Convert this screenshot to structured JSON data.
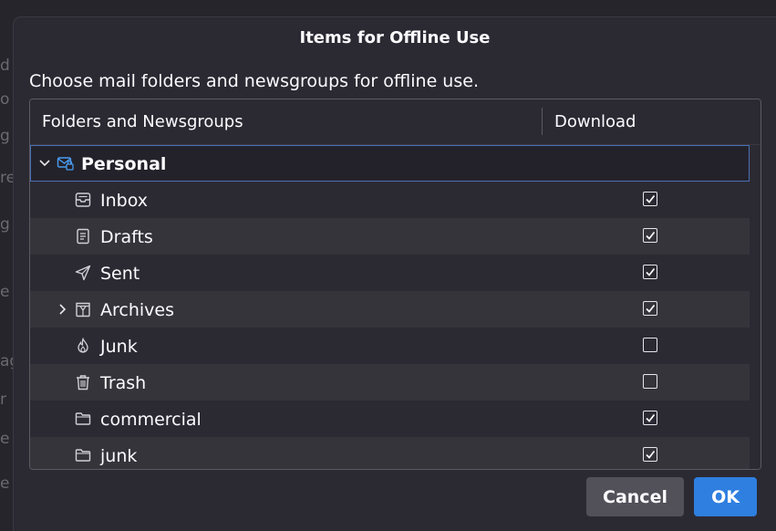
{
  "dialog": {
    "title": "Items for Offline Use",
    "intro": "Choose mail folders and newsgroups for offline use."
  },
  "tree": {
    "columns": [
      "Folders and Newsgroups",
      "Download"
    ],
    "rows": [
      {
        "label": "Personal",
        "icon": "account-envelope-lock-icon",
        "bold": true,
        "twisty": "expanded",
        "checked": null
      },
      {
        "label": "Inbox",
        "icon": "inbox-icon",
        "checked": true
      },
      {
        "label": "Drafts",
        "icon": "drafts-icon",
        "checked": true
      },
      {
        "label": "Sent",
        "icon": "sent-paper-plane-icon",
        "checked": true
      },
      {
        "label": "Archives",
        "icon": "archive-box-icon",
        "twisty": "collapsed",
        "checked": true
      },
      {
        "label": "Junk",
        "icon": "junk-flame-icon",
        "checked": false
      },
      {
        "label": "Trash",
        "icon": "trash-icon",
        "checked": false
      },
      {
        "label": "commercial",
        "icon": "folder-icon",
        "checked": true
      },
      {
        "label": "junk",
        "icon": "folder-icon",
        "checked": true
      }
    ]
  },
  "buttons": {
    "cancel": "Cancel",
    "ok": "OK"
  },
  "background": {
    "letters": [
      "d",
      "o",
      "g",
      "re",
      "g",
      "e",
      "ag",
      "r",
      "e t",
      "e"
    ]
  },
  "colors": {
    "accent": "#2f7fe0",
    "dialog_bg": "#2b2a33",
    "row_alt": "#35343b",
    "text": "#fbfbfe",
    "icon_blue": "#4a9cf0"
  }
}
